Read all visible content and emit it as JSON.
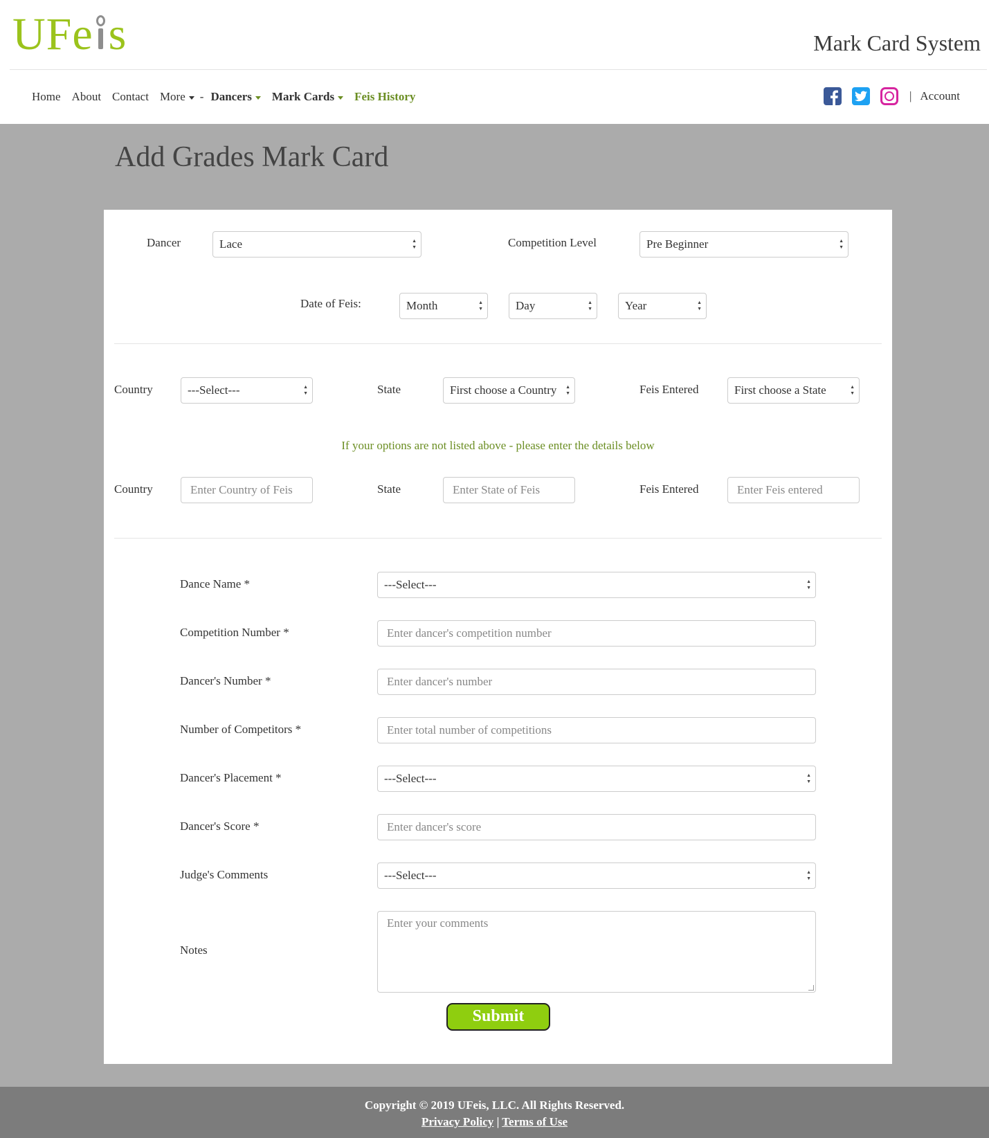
{
  "brand": {
    "logo_text_pre": "UFe",
    "logo_text_post": "s",
    "system_title": "Mark Card System"
  },
  "nav": {
    "items": [
      {
        "label": "Home",
        "style": "plain"
      },
      {
        "label": "About",
        "style": "plain"
      },
      {
        "label": "Contact",
        "style": "plain"
      },
      {
        "label": "More",
        "style": "plain",
        "dropdown": true
      }
    ],
    "separator": "-",
    "member_items": [
      {
        "label": "Dancers",
        "dropdown": true
      },
      {
        "label": "Mark Cards",
        "dropdown": true
      },
      {
        "label": "Feis History",
        "dropdown": false
      }
    ],
    "social": [
      "facebook-icon",
      "twitter-icon",
      "instagram-icon"
    ],
    "divider": "|",
    "account": "Account"
  },
  "page": {
    "title": "Add Grades Mark Card"
  },
  "form": {
    "dancer": {
      "label": "Dancer",
      "value": "Lace"
    },
    "competition_level": {
      "label": "Competition Level",
      "value": "Pre Beginner"
    },
    "date": {
      "label": "Date of Feis:",
      "month": "Month",
      "day": "Day",
      "year": "Year"
    },
    "selects_row": {
      "country": {
        "label": "Country",
        "value": "---Select---"
      },
      "state": {
        "label": "State",
        "value": "First choose a Country"
      },
      "feis": {
        "label": "Feis Entered",
        "value": "First choose a State"
      }
    },
    "hint": "If your options are not listed above - please enter the details below",
    "manual_row": {
      "country": {
        "label": "Country",
        "placeholder": "Enter Country of Feis"
      },
      "state": {
        "label": "State",
        "placeholder": "Enter State of Feis"
      },
      "feis": {
        "label": "Feis Entered",
        "placeholder": "Enter Feis entered"
      }
    },
    "dance_name": {
      "label": "Dance Name *",
      "value": "---Select---"
    },
    "competition_number": {
      "label": "Competition Number *",
      "placeholder": "Enter dancer's competition number"
    },
    "dancer_number": {
      "label": "Dancer's Number *",
      "placeholder": "Enter dancer's number"
    },
    "num_competitors": {
      "label": "Number of Competitors *",
      "placeholder": "Enter total number of competitions"
    },
    "placement": {
      "label": "Dancer's Placement *",
      "value": "---Select---"
    },
    "score": {
      "label": "Dancer's Score *",
      "placeholder": "Enter dancer's score"
    },
    "judges_comments": {
      "label": "Judge's Comments",
      "value": "---Select---"
    },
    "notes": {
      "label": "Notes",
      "placeholder": "Enter your comments"
    },
    "submit": "Submit"
  },
  "footer": {
    "copyright": "Copyright © 2019 UFeis, LLC. All Rights Reserved.",
    "privacy": "Privacy Policy",
    "link_sep": "|",
    "terms": "Terms of Use"
  },
  "colors": {
    "brand_green": "#9bc31c",
    "nav_green": "#6b8e23",
    "submit_green": "#8fce0f",
    "page_bg": "#ababab",
    "footer_bg": "#7c7c7c"
  }
}
